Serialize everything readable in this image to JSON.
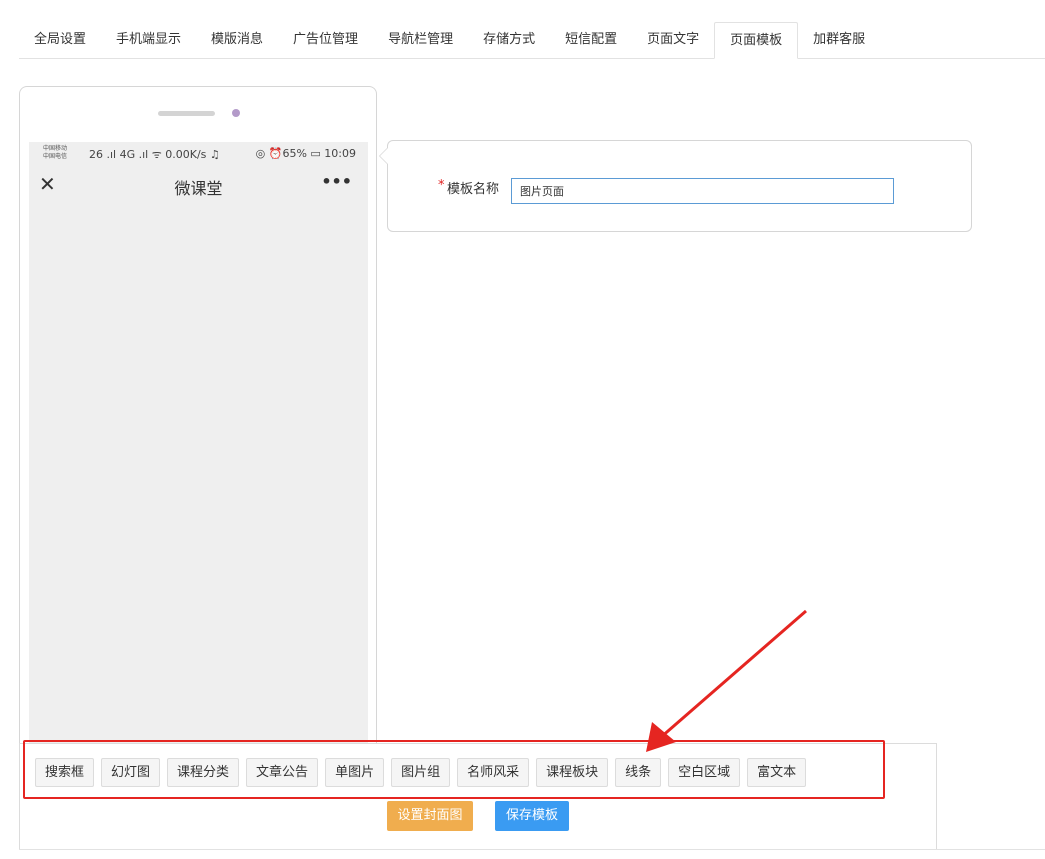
{
  "tabs": [
    {
      "label": "全局设置"
    },
    {
      "label": "手机端显示"
    },
    {
      "label": "模版消息"
    },
    {
      "label": "广告位管理"
    },
    {
      "label": "导航栏管理"
    },
    {
      "label": "存储方式"
    },
    {
      "label": "短信配置"
    },
    {
      "label": "页面文字"
    },
    {
      "label": "页面模板",
      "active": true
    },
    {
      "label": "加群客服"
    }
  ],
  "phone": {
    "status_carrier_top": "中国移动",
    "status_carrier_bottom": "中国电信",
    "status_left": "26 .ıl 4G .ıl ᯤ 0.00K/s ♫",
    "status_right": "◎ ⏰65% ▭ 10:09",
    "close_symbol": "✕",
    "title": "微课堂",
    "more_symbol": "•••"
  },
  "form": {
    "required_mark": "*",
    "name_label": "模板名称",
    "name_value": "图片页面"
  },
  "components": [
    "搜索框",
    "幻灯图",
    "课程分类",
    "文章公告",
    "单图片",
    "图片组",
    "名师风采",
    "课程板块",
    "线条",
    "空白区域",
    "富文本"
  ],
  "actions": {
    "cover_label": "设置封面图",
    "save_label": "保存模板"
  },
  "colors": {
    "highlight": "#e52521",
    "cover_button": "#f0ad4e",
    "save_button": "#3a9bf2",
    "input_border": "#5b9bd5"
  }
}
